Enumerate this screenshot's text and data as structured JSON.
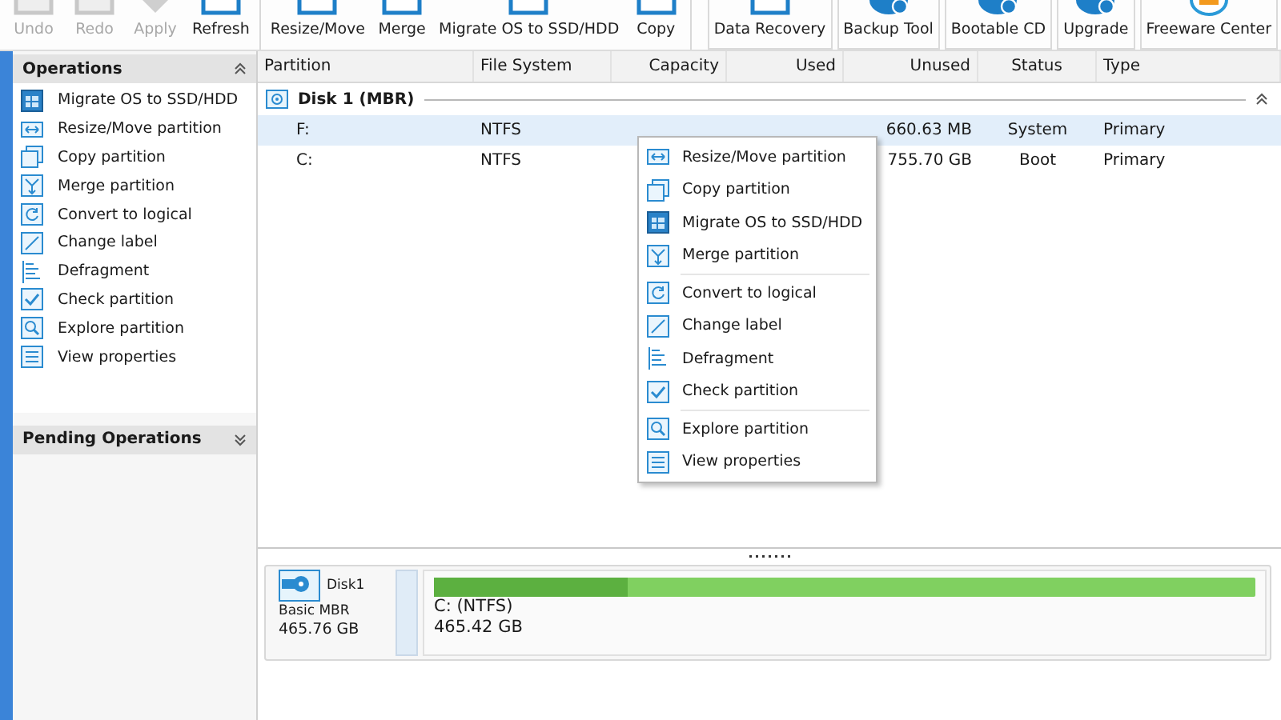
{
  "toolbar": {
    "groups": [
      {
        "buttons": [
          {
            "label": "Undo",
            "disabled": true,
            "kind": "square"
          },
          {
            "label": "Redo",
            "disabled": true,
            "kind": "square"
          },
          {
            "label": "Apply",
            "disabled": true,
            "kind": "diamond"
          },
          {
            "label": "Refresh",
            "disabled": false,
            "kind": "square"
          }
        ]
      },
      {
        "buttons": [
          {
            "label": "Resize/Move",
            "disabled": false,
            "kind": "square"
          },
          {
            "label": "Merge",
            "disabled": false,
            "kind": "square"
          },
          {
            "label": "Migrate OS to SSD/HDD",
            "disabled": false,
            "kind": "square"
          },
          {
            "label": "Copy",
            "disabled": false,
            "kind": "square"
          }
        ]
      },
      {
        "buttons": [
          {
            "label": "Data Recovery",
            "disabled": false,
            "kind": "square"
          },
          {
            "label": "Backup Tool",
            "disabled": false,
            "kind": "circle"
          },
          {
            "label": "Bootable CD",
            "disabled": false,
            "kind": "circle"
          },
          {
            "label": "Upgrade",
            "disabled": false,
            "kind": "circle"
          },
          {
            "label": "Freeware Center",
            "disabled": false,
            "kind": "ring"
          }
        ]
      }
    ]
  },
  "sidebar": {
    "sections": [
      {
        "title": "Operations",
        "expanded": true,
        "items": [
          {
            "label": "Migrate OS to SSD/HDD",
            "kind": "migrate"
          },
          {
            "label": "Resize/Move partition",
            "kind": "resize"
          },
          {
            "label": "Copy partition",
            "kind": "copy"
          },
          {
            "label": "Merge partition",
            "kind": "merge"
          },
          {
            "label": "Convert to logical",
            "kind": "convert"
          },
          {
            "label": "Change label",
            "kind": "label"
          },
          {
            "label": "Defragment",
            "kind": "defrag"
          },
          {
            "label": "Check partition",
            "kind": "check"
          },
          {
            "label": "Explore partition",
            "kind": "explore"
          },
          {
            "label": "View properties",
            "kind": "properties"
          }
        ]
      },
      {
        "title": "Pending Operations",
        "expanded": false
      }
    ]
  },
  "table": {
    "columns": [
      "Partition",
      "File System",
      "Capacity",
      "Used",
      "Unused",
      "Status",
      "Type"
    ],
    "disk": {
      "label": "Disk 1 (MBR)",
      "expanded": true
    },
    "rows": [
      {
        "selected": true,
        "cells": [
          "F:",
          "NTFS",
          "",
          "",
          "660.63 MB",
          "System",
          "Primary"
        ]
      },
      {
        "selected": false,
        "cells": [
          "C:",
          "NTFS",
          "",
          "",
          "755.70 GB",
          "Boot",
          "Primary"
        ]
      }
    ]
  },
  "context_menu": {
    "groups": [
      [
        {
          "label": "Resize/Move partition",
          "kind": "resize"
        },
        {
          "label": "Copy partition",
          "kind": "copy"
        },
        {
          "label": "Migrate OS to SSD/HDD",
          "kind": "migrate"
        },
        {
          "label": "Merge partition",
          "kind": "merge"
        }
      ],
      [
        {
          "label": "Convert to logical",
          "kind": "convert"
        },
        {
          "label": "Change label",
          "kind": "label"
        },
        {
          "label": "Defragment",
          "kind": "defrag"
        },
        {
          "label": "Check partition",
          "kind": "check"
        }
      ],
      [
        {
          "label": "Explore partition",
          "kind": "explore"
        },
        {
          "label": "View properties",
          "kind": "properties"
        }
      ]
    ]
  },
  "disk_map": {
    "name": "Disk1",
    "type": "Basic MBR",
    "size": "465.76 GB",
    "partitions": [
      {
        "label": "C: (NTFS)",
        "size": "465.42 GB",
        "level": 0.235
      }
    ]
  }
}
